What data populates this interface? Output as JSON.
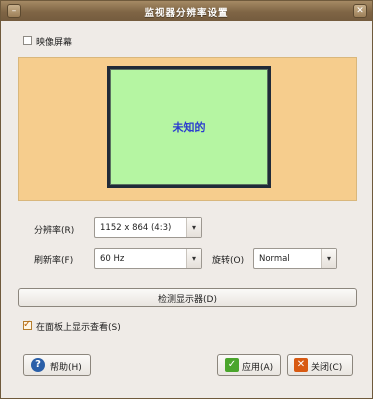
{
  "window": {
    "title": "监视器分辨率设置",
    "minimize_symbol": "–",
    "close_symbol": "✕"
  },
  "mirror": {
    "label": "映像屏幕",
    "checked": false
  },
  "monitor": {
    "name": "未知的"
  },
  "resolution": {
    "label": "分辨率(R)",
    "value": "1152 x 864 (4:3)"
  },
  "refresh": {
    "label": "刷新率(F)",
    "value": "60 Hz"
  },
  "rotation": {
    "label": "旋转(O)",
    "value": "Normal"
  },
  "detect_button": {
    "label": "检测显示器(D)"
  },
  "show_in_panel": {
    "label": "在面板上显示查看(S)",
    "checked": true
  },
  "buttons": {
    "help": {
      "label": "帮助(H)",
      "icon": "help-icon"
    },
    "apply": {
      "label": "应用(A)",
      "icon": "check-icon"
    },
    "close": {
      "label": "关闭(C)",
      "icon": "close-icon"
    }
  },
  "colors": {
    "title_bar": "#7f6545",
    "monitor_area": "#f6cd8d",
    "monitor_screen": "#b5f5a2",
    "monitor_label": "#2b3ecf",
    "help_icon": "#2a5fa8",
    "apply_icon": "#4aa52c",
    "close_icon": "#d85a12"
  }
}
